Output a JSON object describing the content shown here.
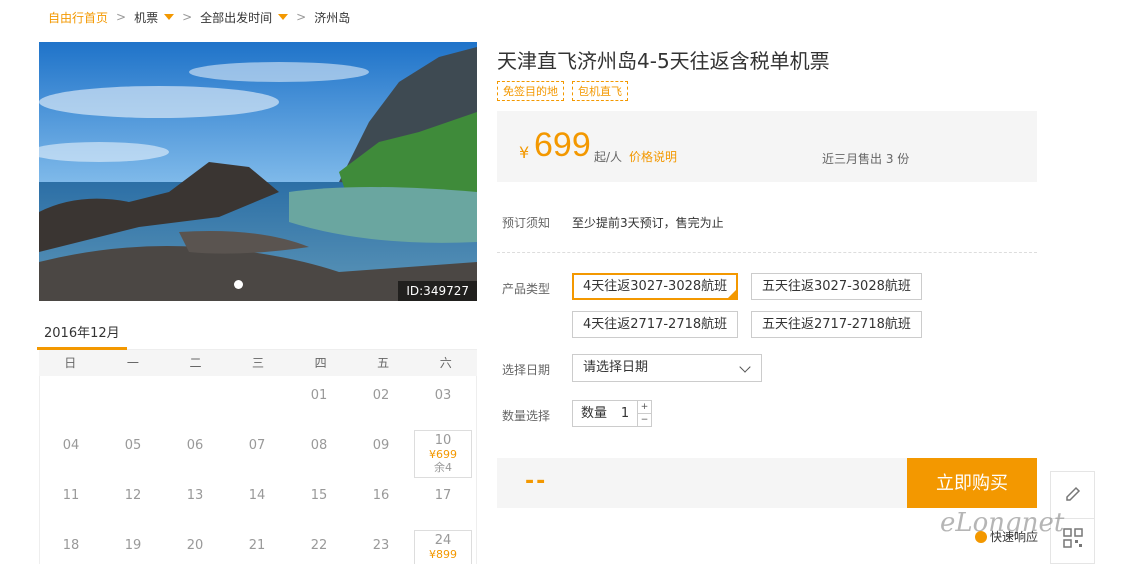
{
  "breadcrumb": {
    "home": "自由行首页",
    "flights": "机票",
    "departure": "全部出发时间",
    "destination": "济州岛",
    "sep": ">"
  },
  "hero": {
    "id_label": "ID:349727"
  },
  "calendar": {
    "month": "2016年12月",
    "weekdays": [
      "日",
      "一",
      "二",
      "三",
      "四",
      "五",
      "六"
    ],
    "rows": [
      [
        "",
        "",
        "",
        "",
        "01",
        "02",
        "03"
      ],
      [
        "04",
        "05",
        "06",
        "07",
        "08",
        "09",
        "10"
      ],
      [
        "11",
        "12",
        "13",
        "14",
        "15",
        "16",
        "17"
      ],
      [
        "18",
        "19",
        "20",
        "21",
        "22",
        "23",
        "24"
      ]
    ],
    "available": [
      {
        "day": "10",
        "price": "¥699",
        "stock": "余4"
      },
      {
        "day": "24",
        "price": "¥899",
        "stock": ""
      }
    ]
  },
  "product": {
    "title": "天津直飞济州岛4-5天往返含税单机票",
    "tags": [
      "免签目的地",
      "包机直飞"
    ]
  },
  "price": {
    "currency": "¥",
    "amount": "699",
    "unit": "起/人",
    "explain": "价格说明",
    "sold": "近三月售出 3 份"
  },
  "booking": {
    "notice_label": "预订须知",
    "notice_text": "至少提前3天预订，售完为止",
    "type_label": "产品类型",
    "types": [
      "4天往返3027-3028航班",
      "五天往返3027-3028航班",
      "4天往返2717-2718航班",
      "五天往返2717-2718航班"
    ],
    "date_label": "选择日期",
    "date_placeholder": "请选择日期",
    "qty_label": "数量选择",
    "qty_inner_label": "数量",
    "qty_value": "1",
    "qty_plus": "+",
    "qty_minus": "−"
  },
  "buy": {
    "total": "--",
    "button": "立即购买"
  },
  "floating": {
    "quick": "快速响应"
  },
  "watermark": "eLongnet",
  "colors": {
    "accent": "#f39800",
    "panel": "#f5f5f5"
  }
}
